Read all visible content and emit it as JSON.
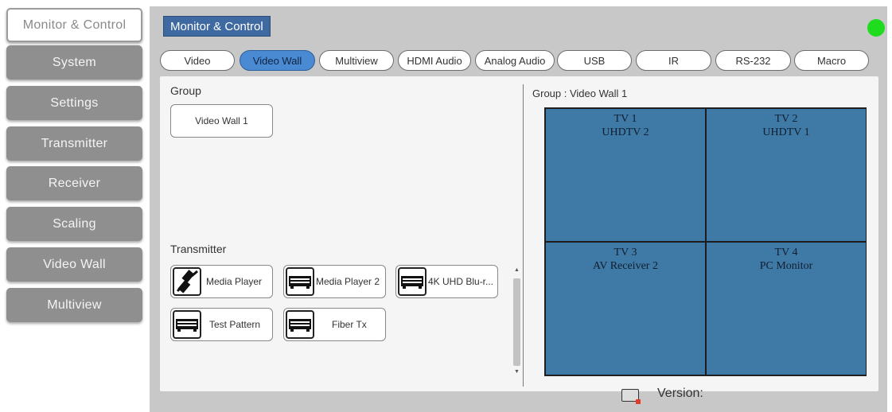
{
  "sidebar": {
    "items": [
      {
        "label": "Monitor & Control",
        "active": true
      },
      {
        "label": "System",
        "active": false
      },
      {
        "label": "Settings",
        "active": false
      },
      {
        "label": "Transmitter",
        "active": false
      },
      {
        "label": "Receiver",
        "active": false
      },
      {
        "label": "Scaling",
        "active": false
      },
      {
        "label": "Video Wall",
        "active": false
      },
      {
        "label": "Multiview",
        "active": false
      }
    ]
  },
  "header": {
    "title": "Monitor & Control",
    "status_color": "#1fdc1f"
  },
  "tabs": [
    {
      "label": "Video",
      "active": false
    },
    {
      "label": "Video Wall",
      "active": true
    },
    {
      "label": "Multiview",
      "active": false
    },
    {
      "label": "HDMI Audio",
      "active": false
    },
    {
      "label": "Analog Audio",
      "active": false
    },
    {
      "label": "USB",
      "active": false
    },
    {
      "label": "IR",
      "active": false
    },
    {
      "label": "RS-232",
      "active": false
    },
    {
      "label": "Macro",
      "active": false
    }
  ],
  "group_panel": {
    "label": "Group",
    "groups": [
      "Video Wall 1"
    ]
  },
  "transmitter_panel": {
    "label": "Transmitter",
    "items": [
      {
        "name": "Media Player",
        "icon": "disconnected-plug-icon"
      },
      {
        "name": "Media Player 2",
        "icon": "av-device-icon"
      },
      {
        "name": "4K UHD Blu-r...",
        "icon": "av-device-icon"
      },
      {
        "name": "Test Pattern",
        "icon": "av-device-icon"
      },
      {
        "name": "Fiber Tx",
        "icon": "av-device-icon"
      }
    ]
  },
  "wall": {
    "title": "Group : Video Wall 1",
    "tiles": [
      {
        "tv": "TV 1",
        "source": "UHDTV 2"
      },
      {
        "tv": "TV 2",
        "source": "UHDTV 1"
      },
      {
        "tv": "TV 3",
        "source": "AV Receiver 2"
      },
      {
        "tv": "TV 4",
        "source": "PC Monitor"
      }
    ]
  },
  "footer": {
    "version_label": "Version:"
  },
  "colors": {
    "accent": "#4a8ad3",
    "wall_tile": "#3f79a6",
    "sidebar_button": "#8f8f8f"
  }
}
